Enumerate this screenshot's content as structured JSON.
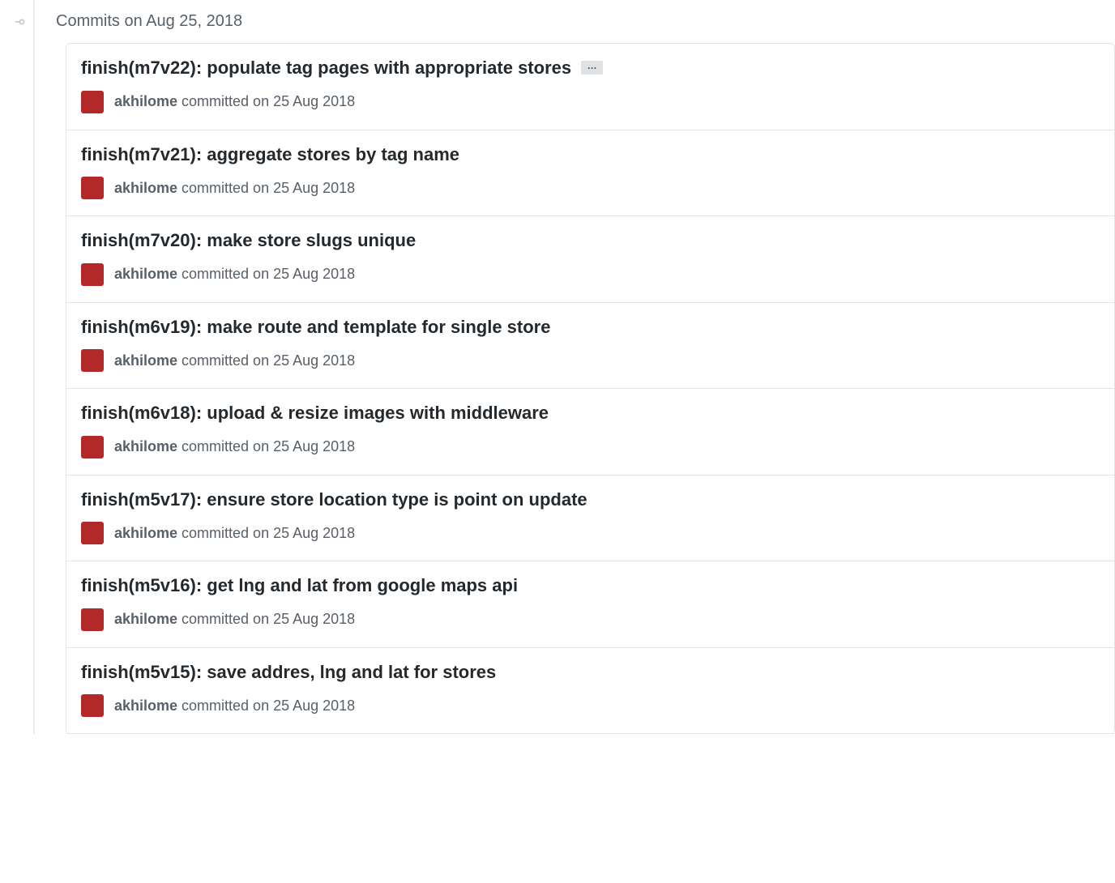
{
  "group": {
    "title": "Commits on Aug 25, 2018"
  },
  "commits": [
    {
      "title": "finish(m7v22): populate tag pages with appropriate stores",
      "has_ellipsis": true,
      "author": "akhilome",
      "meta": "committed on 25 Aug 2018"
    },
    {
      "title": "finish(m7v21): aggregate stores by tag name",
      "has_ellipsis": false,
      "author": "akhilome",
      "meta": "committed on 25 Aug 2018"
    },
    {
      "title": "finish(m7v20): make store slugs unique",
      "has_ellipsis": false,
      "author": "akhilome",
      "meta": "committed on 25 Aug 2018"
    },
    {
      "title": "finish(m6v19): make route and template for single store",
      "has_ellipsis": false,
      "author": "akhilome",
      "meta": "committed on 25 Aug 2018"
    },
    {
      "title": "finish(m6v18): upload & resize images with middleware",
      "has_ellipsis": false,
      "author": "akhilome",
      "meta": "committed on 25 Aug 2018"
    },
    {
      "title": "finish(m5v17): ensure store location type is point on update",
      "has_ellipsis": false,
      "author": "akhilome",
      "meta": "committed on 25 Aug 2018"
    },
    {
      "title": "finish(m5v16): get lng and lat from google maps api",
      "has_ellipsis": false,
      "author": "akhilome",
      "meta": "committed on 25 Aug 2018"
    },
    {
      "title": "finish(m5v15): save addres, lng and lat for stores",
      "has_ellipsis": false,
      "author": "akhilome",
      "meta": "committed on 25 Aug 2018"
    }
  ]
}
